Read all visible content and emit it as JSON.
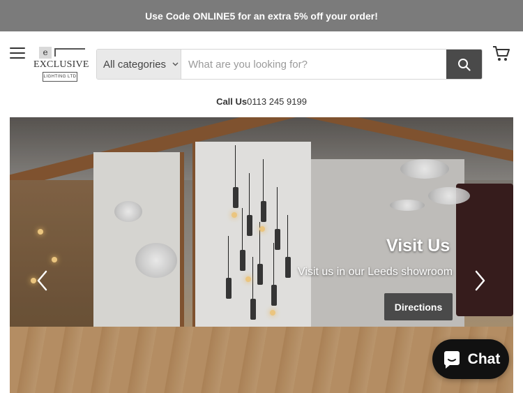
{
  "promo": {
    "text": "Use Code ONLINE5 for an extra 5% off your order!"
  },
  "header": {
    "menu_icon": "hamburger-menu-icon",
    "logo": {
      "mark": "e",
      "brand": "EXCLUSIVE",
      "sub": "LIGHTING LTD"
    },
    "search": {
      "category_label": "All categories",
      "placeholder": "What are you looking for?",
      "button_icon": "search-icon"
    },
    "cart_icon": "cart-icon",
    "call_label": "Call Us",
    "phone": "0113 245 9199"
  },
  "hero": {
    "title": "Visit Us",
    "subtitle": "Visit us in our Leeds showroom",
    "button_label": "Directions",
    "prev_icon": "chevron-left-icon",
    "next_icon": "chevron-right-icon"
  },
  "chat": {
    "label": "Chat",
    "icon": "chat-bubble-icon"
  },
  "colors": {
    "promo_bg": "#7b7b7b",
    "button_dark": "#4a4a4a",
    "chat_bg": "#111111"
  }
}
